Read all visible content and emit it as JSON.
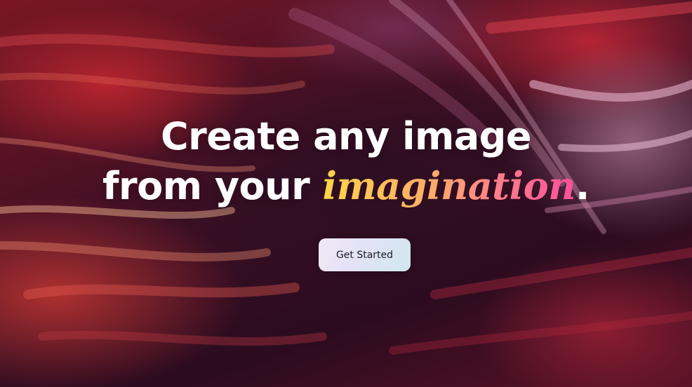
{
  "hero": {
    "headline_line1": "Create any image",
    "headline_line2_prefix": "from your ",
    "headline_accent": "imagination",
    "headline_period": ".",
    "cta_label": "Get Started"
  },
  "colors": {
    "accent_gradient": [
      "#ffd54a",
      "#ffb066",
      "#ff7d8c",
      "#ff4f9a"
    ],
    "headline_text": "#ffffff",
    "button_text": "#1b1b24"
  }
}
